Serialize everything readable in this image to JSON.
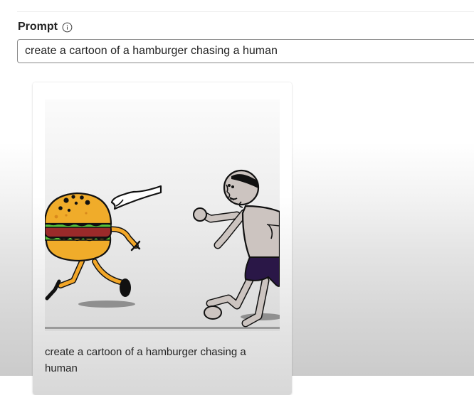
{
  "prompt": {
    "label": "Prompt",
    "info_icon": "info-icon",
    "value": "create a cartoon of a hamburger chasing a human"
  },
  "results": [
    {
      "image_icon": "generated-image",
      "caption": "create a cartoon of a hamburger chasing a human"
    }
  ]
}
